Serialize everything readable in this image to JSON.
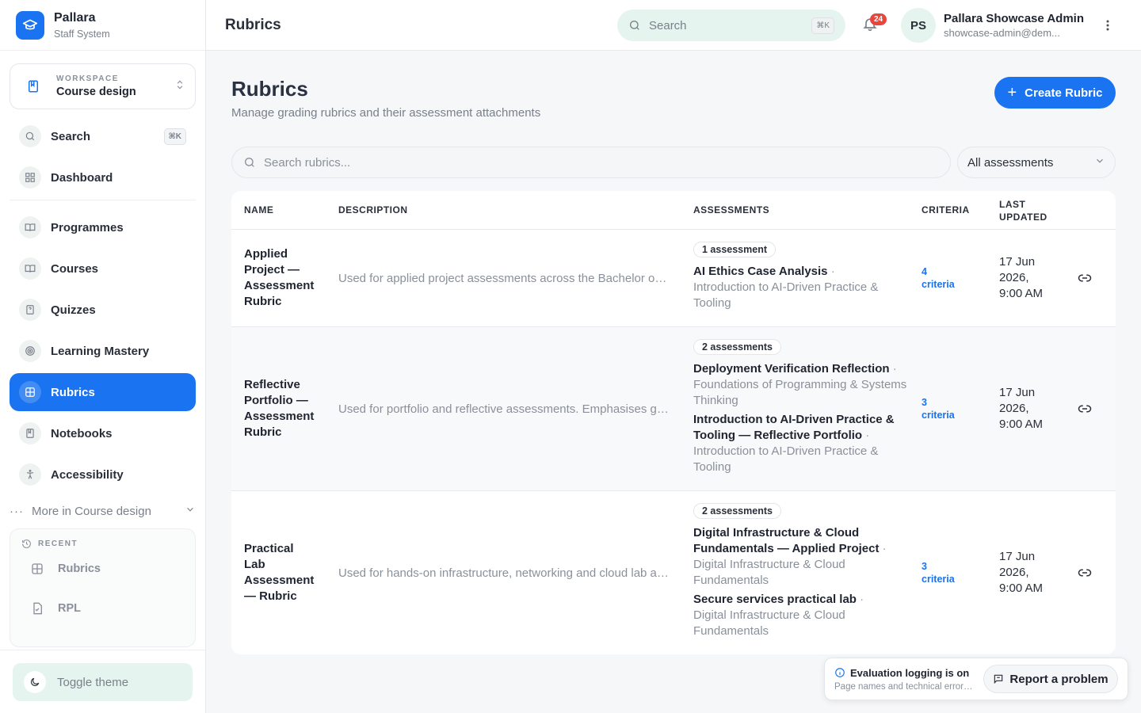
{
  "brand": {
    "name": "Pallara",
    "subtitle": "Staff System"
  },
  "workspace": {
    "label": "WORKSPACE",
    "value": "Course design"
  },
  "sidebar": {
    "search": {
      "label": "Search",
      "shortcut": "⌘K"
    },
    "items": [
      {
        "label": "Dashboard",
        "icon": "grid-icon"
      },
      {
        "label": "Programmes",
        "icon": "book-open-icon"
      },
      {
        "label": "Courses",
        "icon": "book-open-icon"
      },
      {
        "label": "Quizzes",
        "icon": "quiz-file-icon"
      },
      {
        "label": "Learning Mastery",
        "icon": "target-icon"
      },
      {
        "label": "Rubrics",
        "icon": "rubric-grid-icon",
        "active": true
      },
      {
        "label": "Notebooks",
        "icon": "notebook-icon"
      },
      {
        "label": "Accessibility",
        "icon": "accessibility-icon"
      }
    ],
    "more": "More in Course design",
    "recent": {
      "label": "RECENT",
      "items": [
        {
          "label": "Rubrics",
          "icon": "rubric-grid-icon"
        },
        {
          "label": "RPL",
          "icon": "document-icon"
        }
      ]
    },
    "toggle_theme": "Toggle theme"
  },
  "topbar": {
    "title": "Rubrics",
    "search_placeholder": "Search",
    "search_shortcut": "⌘K",
    "notifications_count": "24",
    "user": {
      "initials": "PS",
      "name": "Pallara Showcase Admin",
      "email": "showcase-admin@dem..."
    }
  },
  "page": {
    "title": "Rubrics",
    "subtitle": "Manage grading rubrics and their assessment attachments",
    "create_button": "Create Rubric",
    "search_placeholder": "Search rubrics...",
    "filter_value": "All assessments"
  },
  "table": {
    "headers": {
      "name": "NAME",
      "description": "DESCRIPTION",
      "assessments": "ASSESSMENTS",
      "criteria": "CRITERIA",
      "updated_1": "LAST",
      "updated_2": "UPDATED"
    },
    "rows": [
      {
        "name": [
          "Applied",
          "Project —",
          "Assessment",
          "Rubric"
        ],
        "description": "Used for applied project assessments across the Bachelor of Applied Technology.",
        "badge": "1 assessment",
        "assessments": [
          {
            "title": "AI Ethics Case Analysis",
            "course": "Introduction to AI-Driven Practice & Tooling"
          }
        ],
        "criteria": [
          "4",
          "criteria"
        ],
        "updated": [
          "17 Jun",
          "2026,",
          "9:00 AM"
        ]
      },
      {
        "name": [
          "Reflective",
          "Portfolio —",
          "Assessment",
          "Rubric"
        ],
        "description": "Used for portfolio and reflective assessments. Emphasises growth and reflection.",
        "badge": "2 assessments",
        "assessments": [
          {
            "title": "Deployment Verification Reflection",
            "course": "Foundations of Programming & Systems Thinking"
          },
          {
            "title": "Introduction to AI-Driven Practice & Tooling — Reflective Portfolio",
            "course": "Introduction to AI-Driven Practice & Tooling"
          }
        ],
        "criteria": [
          "3",
          "criteria"
        ],
        "updated": [
          "17 Jun",
          "2026,",
          "9:00 AM"
        ]
      },
      {
        "name": [
          "Practical",
          "Lab",
          "Assessment",
          "— Rubric"
        ],
        "description": "Used for hands-on infrastructure, networking and cloud lab assessments.",
        "badge": "2 assessments",
        "assessments": [
          {
            "title": "Digital Infrastructure & Cloud Fundamentals — Applied Project",
            "course": "Digital Infrastructure & Cloud Fundamentals"
          },
          {
            "title": "Secure services practical lab",
            "course": "Digital Infrastructure & Cloud Fundamentals"
          }
        ],
        "criteria": [
          "3",
          "criteria"
        ],
        "updated": [
          "17 Jun",
          "2026,",
          "9:00 AM"
        ]
      }
    ]
  },
  "toast": {
    "title": "Evaluation logging is on",
    "subtitle": "Page names and technical errors are recorded",
    "report_button": "Report a problem"
  },
  "colors": {
    "accent": "#1a73f0",
    "mint": "#e6f4ef",
    "badge_red": "#e8453c"
  }
}
